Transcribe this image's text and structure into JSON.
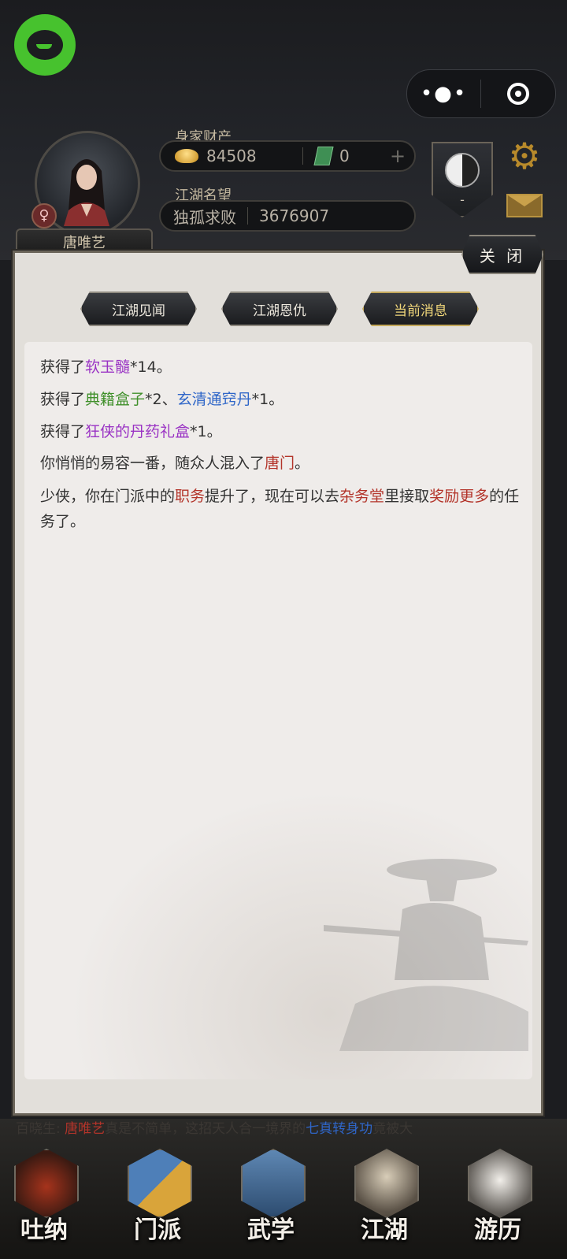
{
  "header": {
    "wealth_label": "身家财产",
    "gold_amount": "84508",
    "jade_amount": "0",
    "reputation_label": "江湖名望",
    "reputation_title": "独孤求败",
    "reputation_value": "3676907",
    "taiji_level": "-",
    "more_glyph": "•●•",
    "gear_glyph": "⚙"
  },
  "player": {
    "name": "唐唯艺",
    "gender_symbol": "♀"
  },
  "panel": {
    "close_label": "关 闭",
    "tabs": [
      {
        "label": "江湖见闻"
      },
      {
        "label": "江湖恩仇"
      },
      {
        "label": "当前消息"
      }
    ],
    "messages": [
      {
        "segments": [
          {
            "t": "获得了"
          },
          {
            "t": "软玉髓",
            "c": "purple"
          },
          {
            "t": "*14。"
          }
        ]
      },
      {
        "segments": [
          {
            "t": "获得了"
          },
          {
            "t": "典籍盒子",
            "c": "green"
          },
          {
            "t": "*2、"
          },
          {
            "t": "玄清通窍丹",
            "c": "blue"
          },
          {
            "t": "*1。"
          }
        ]
      },
      {
        "segments": [
          {
            "t": "获得了"
          },
          {
            "t": "狂侠的丹药礼盒",
            "c": "purple"
          },
          {
            "t": "*1。"
          }
        ]
      },
      {
        "segments": [
          {
            "t": "你悄悄的易容一番，随众人混入了"
          },
          {
            "t": "唐门",
            "c": "red"
          },
          {
            "t": "。"
          }
        ]
      },
      {
        "segments": [
          {
            "t": "少侠，你在门派中的"
          },
          {
            "t": "职务",
            "c": "red"
          },
          {
            "t": "提升了，现在可以去"
          },
          {
            "t": "杂务堂",
            "c": "red"
          },
          {
            "t": "里接取"
          },
          {
            "t": "奖励更多",
            "c": "red"
          },
          {
            "t": "的任务了。"
          }
        ]
      }
    ]
  },
  "marquee": {
    "prefix": "百晓生: ",
    "name": "唐唯艺",
    "middle": "真是不简单，这招天人合一境界的",
    "skill": "七真转身功",
    "suffix": "竟被大"
  },
  "nav": [
    {
      "label": "吐纳"
    },
    {
      "label": "门派"
    },
    {
      "label": "武学"
    },
    {
      "label": "江湖"
    },
    {
      "label": "游历"
    }
  ],
  "colors": {
    "purple": "#9a33c4",
    "green": "#3f8f2a",
    "blue": "#2f66c8",
    "red": "#b3342a",
    "active_tab": "#f1d77a",
    "app_icon": "#47c22e"
  }
}
